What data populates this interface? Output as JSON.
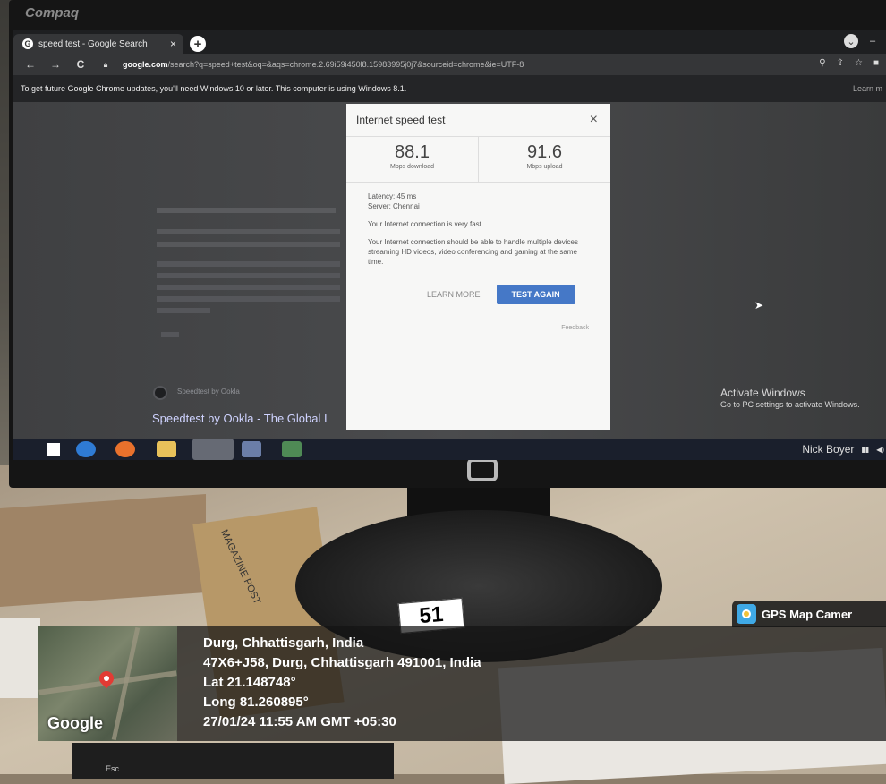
{
  "monitor": {
    "brand": "Compaq"
  },
  "browser": {
    "tab_title": "speed test - Google Search",
    "tab_close": "×",
    "new_tab": "+",
    "nav_back": "←",
    "nav_forward": "→",
    "nav_reload": "C",
    "url_host": "google.com",
    "url_path": "/search?q=speed+test&oq=&aqs=chrome.2.69i59i450l8.15983995j0j7&sourceid=chrome&ie=UTF-8",
    "infobar_text": "To get future Google Chrome updates, you'll need Windows 10 or later. This computer is using Windows 8.1.",
    "infobar_link": "Learn m"
  },
  "speed_test": {
    "title": "Internet speed test",
    "close": "×",
    "download_value": "88.1",
    "download_unit": "Mbps download",
    "upload_value": "91.6",
    "upload_unit": "Mbps upload",
    "latency": "Latency: 45 ms",
    "server": "Server: Chennai",
    "verdict": "Your Internet connection is very fast.",
    "description": "Your Internet connection should be able to handle multiple devices streaming HD videos, video conferencing and gaming at the same time.",
    "learn_more": "LEARN MORE",
    "test_again": "TEST AGAIN",
    "feedback": "Feedback"
  },
  "background_results": {
    "site_name": "Speedtest by Ookla",
    "title": "Speedtest by Ookla - The Global I"
  },
  "windows": {
    "activate_title": "Activate Windows",
    "activate_sub": "Go to PC settings to activate Windows.",
    "taskbar_user": "Nick Boyer"
  },
  "gps": {
    "app_label": "GPS Map Camer",
    "map_logo": "Google",
    "line1": "Durg, Chhattisgarh, India",
    "line2": "47X6+J58, Durg, Chhattisgarh 491001, India",
    "line3": "Lat 21.148748°",
    "line4": "Long 81.260895°",
    "line5": "27/01/24 11:55 AM GMT +05:30"
  },
  "desk": {
    "sticker_number": "51",
    "envelope_text": "MAGAZINE POST",
    "keyboard_esc": "Esc"
  },
  "colors": {
    "dialog_button": "#4578c7",
    "gps_panel": "#141414",
    "pin": "#e23b34"
  }
}
